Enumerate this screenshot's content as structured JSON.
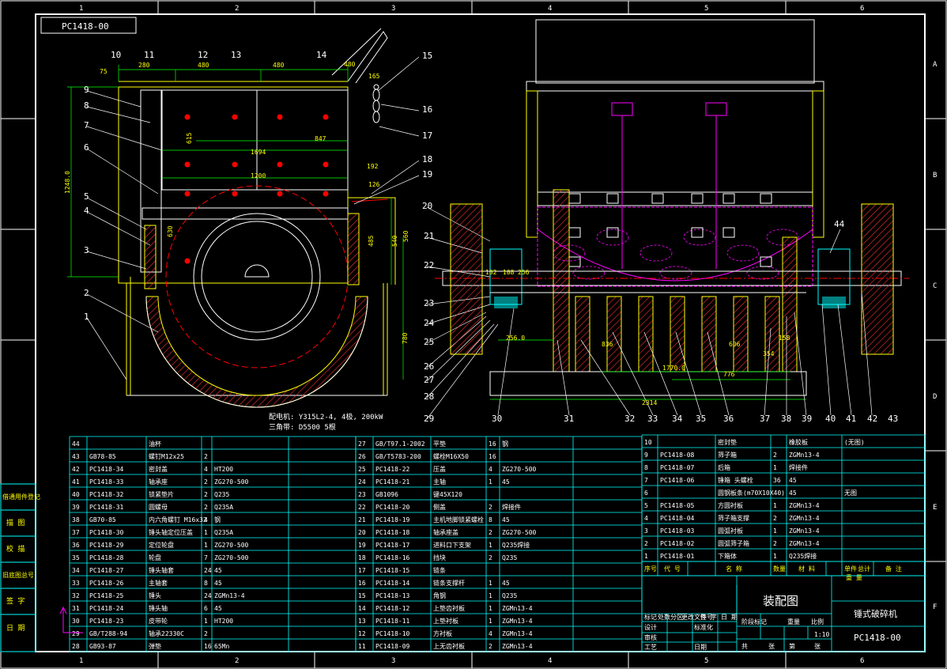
{
  "drawing": {
    "code_stamp": "PC1418-00",
    "title": "装配图",
    "machine_name": "锤式破碎机",
    "drawing_no": "PC1418-00",
    "scale": "1:10",
    "motor_note_1": "配电机: Y315L2-4, 4极, 200kW",
    "motor_note_2": "三角带: D5500  5根"
  },
  "grid": {
    "cols": [
      "1",
      "2",
      "3",
      "4",
      "5",
      "6"
    ],
    "rows": [
      "A",
      "B",
      "C",
      "D",
      "E",
      "F"
    ]
  },
  "side_panel": [
    "借通用件登记",
    "描 图",
    "校 描",
    "旧底图总号",
    "签 字",
    "日 期"
  ],
  "dimensions": [
    "75",
    "280",
    "480",
    "480",
    "480",
    "165",
    "615",
    "1694",
    "847",
    "1200",
    "1248.0",
    "192",
    "126",
    "630",
    "485",
    "540",
    "560",
    "780",
    "256.0",
    "836",
    "102",
    "108",
    "256",
    "1770.0",
    "2314",
    "776",
    "354",
    "158",
    "606"
  ],
  "balloons_left": [
    "9",
    "8",
    "7",
    "6",
    "5",
    "4",
    "3",
    "2",
    "1"
  ],
  "balloons_top": [
    "10",
    "11",
    "12",
    "13",
    "14"
  ],
  "balloons_right": [
    "15",
    "16",
    "17",
    "18",
    "19",
    "20",
    "21",
    "22",
    "23",
    "24",
    "25",
    "26",
    "27",
    "28",
    "29"
  ],
  "balloons_bottom": [
    "30",
    "31",
    "32",
    "33",
    "34",
    "35",
    "36",
    "37",
    "38",
    "39",
    "40",
    "41",
    "42",
    "43"
  ],
  "balloon_44": "44",
  "bom_left": [
    [
      "44",
      "",
      "油杯",
      "",
      "",
      ""
    ],
    [
      "43",
      "GB78-85",
      "螺钉M12x25",
      "2",
      "",
      ""
    ],
    [
      "42",
      "PC1418-34",
      "密封盖",
      "4",
      "HT200",
      ""
    ],
    [
      "41",
      "PC1418-33",
      "轴承座",
      "2",
      "ZG270-500",
      ""
    ],
    [
      "40",
      "PC1418-32",
      "锁紧垫片",
      "2",
      "Q235",
      ""
    ],
    [
      "39",
      "PC1418-31",
      "圆螺母",
      "2",
      "Q235A",
      ""
    ],
    [
      "38",
      "GB70-85",
      "内六角螺钉 M16x32",
      "4",
      "钢",
      ""
    ],
    [
      "37",
      "PC1418-30",
      "锤头轴定位压盖",
      "1",
      "Q235A",
      ""
    ],
    [
      "36",
      "PC1418-29",
      "定位轮盘",
      "1",
      "ZG270-500",
      ""
    ],
    [
      "35",
      "PC1418-28",
      "轮盘",
      "7",
      "ZG270-500",
      ""
    ],
    [
      "34",
      "PC1418-27",
      "锤头轴套",
      "24",
      "45",
      ""
    ],
    [
      "33",
      "PC1418-26",
      "主轴套",
      "8",
      "45",
      ""
    ],
    [
      "32",
      "PC1418-25",
      "锤头",
      "24",
      "ZGMn13-4",
      ""
    ],
    [
      "31",
      "PC1418-24",
      "锤头轴",
      "6",
      "45",
      ""
    ],
    [
      "30",
      "PC1418-23",
      "皮带轮",
      "1",
      "HT200",
      ""
    ],
    [
      "29",
      "GB/T288-94",
      "轴承22330C",
      "2",
      "",
      ""
    ],
    [
      "28",
      "GB93-87",
      "弹垫",
      "16",
      "65Mn",
      ""
    ]
  ],
  "bom_mid": [
    [
      "27",
      "GB/T97.1-2002",
      "平垫",
      "16",
      "钢",
      ""
    ],
    [
      "26",
      "GB/T5783-200",
      "螺栓M16X50",
      "16",
      "",
      ""
    ],
    [
      "25",
      "PC1418-22",
      "压盖",
      "4",
      "ZG270-500",
      ""
    ],
    [
      "24",
      "PC1418-21",
      "主轴",
      "1",
      "45",
      ""
    ],
    [
      "23",
      "GB1096",
      "键45X120",
      "",
      "",
      ""
    ],
    [
      "22",
      "PC1418-20",
      "侧盖",
      "2",
      "焊接件",
      ""
    ],
    [
      "21",
      "PC1418-19",
      "主机地脚锁紧螺栓",
      "8",
      "45",
      ""
    ],
    [
      "20",
      "PC1418-18",
      "轴承座盖",
      "2",
      "ZG270-500",
      ""
    ],
    [
      "19",
      "PC1418-17",
      "进料口下支架",
      "1",
      "Q235焊接",
      ""
    ],
    [
      "18",
      "PC1418-16",
      "挡块",
      "2",
      "Q235",
      ""
    ],
    [
      "17",
      "PC1418-15",
      "链条",
      "",
      "",
      ""
    ],
    [
      "16",
      "PC1418-14",
      "链条支撑杆",
      "1",
      "45",
      ""
    ],
    [
      "15",
      "PC1418-13",
      "角钢",
      "1",
      "Q235",
      ""
    ],
    [
      "14",
      "PC1418-12",
      "上垫齿衬板",
      "1",
      "ZGMn13-4",
      ""
    ],
    [
      "13",
      "PC1418-11",
      "上垫衬板",
      "1",
      "ZGMn13-4",
      ""
    ],
    [
      "12",
      "PC1418-10",
      "方衬板",
      "4",
      "ZGMn13-4",
      ""
    ],
    [
      "11",
      "PC1418-09",
      "上无齿衬板",
      "2",
      "ZGMn13-4",
      ""
    ]
  ],
  "bom_right": [
    [
      "10",
      "",
      "密封垫",
      "",
      "橡胶板",
      "(无图)"
    ],
    [
      "9",
      "PC1418-08",
      "筛子箱",
      "2",
      "ZGMn13-4",
      ""
    ],
    [
      "8",
      "PC1418-07",
      "后箱",
      "1",
      "焊接件",
      ""
    ],
    [
      "7",
      "PC1418-06",
      "锤箱 头螺栓",
      "36",
      "45",
      ""
    ],
    [
      "6",
      "",
      "圆钢板条(m70X10X40)",
      "",
      "45",
      "无图"
    ],
    [
      "5",
      "PC1418-05",
      "方圆衬板",
      "1",
      "ZGMn13-4",
      ""
    ],
    [
      "4",
      "PC1418-04",
      "筛子箱支撑",
      "2",
      "ZGMn13-4",
      ""
    ],
    [
      "3",
      "PC1418-03",
      "圆弧衬板",
      "1",
      "ZGMn13-4",
      ""
    ],
    [
      "2",
      "PC1418-02",
      "圆弧筛子箱",
      "2",
      "ZGMn13-4",
      ""
    ],
    [
      "1",
      "PC1418-01",
      "下箱体",
      "1",
      "Q235焊接",
      ""
    ]
  ],
  "bom_header": [
    "序号",
    "代 号",
    "名 称",
    "数量",
    "材 料",
    "单件",
    "总计",
    "备 注"
  ],
  "bom_header_sub": "重 量",
  "title_block": {
    "row1": [
      "标记",
      "处数",
      "分区",
      "更改文件号",
      "签 字",
      "日 期"
    ],
    "row2": [
      "设计",
      "标准化"
    ],
    "row3": [
      "审核"
    ],
    "row4": [
      "工艺",
      "日期"
    ],
    "stage": [
      "阶段标记",
      "重量",
      "比例"
    ],
    "sheet": [
      "共",
      "张",
      "第",
      "张"
    ]
  },
  "colors": {
    "frame": "#ffffff",
    "outline": "#ffff00",
    "table": "#00ffff",
    "hatch": "#ff3030",
    "rotor": "#ff00ff",
    "red": "#ff0000",
    "green": "#00ff00",
    "cyan": "#00ffff",
    "magenta": "#ff00ff"
  }
}
